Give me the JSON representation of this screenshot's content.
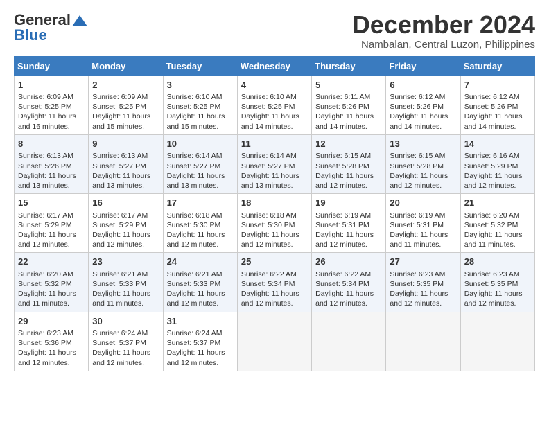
{
  "logo": {
    "line1": "General",
    "line2": "Blue"
  },
  "title": "December 2024",
  "location": "Nambalan, Central Luzon, Philippines",
  "days_of_week": [
    "Sunday",
    "Monday",
    "Tuesday",
    "Wednesday",
    "Thursday",
    "Friday",
    "Saturday"
  ],
  "weeks": [
    [
      {
        "day": 1,
        "sunrise": "6:09 AM",
        "sunset": "5:25 PM",
        "daylight": "11 hours and 16 minutes."
      },
      {
        "day": 2,
        "sunrise": "6:09 AM",
        "sunset": "5:25 PM",
        "daylight": "11 hours and 15 minutes."
      },
      {
        "day": 3,
        "sunrise": "6:10 AM",
        "sunset": "5:25 PM",
        "daylight": "11 hours and 15 minutes."
      },
      {
        "day": 4,
        "sunrise": "6:10 AM",
        "sunset": "5:25 PM",
        "daylight": "11 hours and 14 minutes."
      },
      {
        "day": 5,
        "sunrise": "6:11 AM",
        "sunset": "5:26 PM",
        "daylight": "11 hours and 14 minutes."
      },
      {
        "day": 6,
        "sunrise": "6:12 AM",
        "sunset": "5:26 PM",
        "daylight": "11 hours and 14 minutes."
      },
      {
        "day": 7,
        "sunrise": "6:12 AM",
        "sunset": "5:26 PM",
        "daylight": "11 hours and 14 minutes."
      }
    ],
    [
      {
        "day": 8,
        "sunrise": "6:13 AM",
        "sunset": "5:26 PM",
        "daylight": "11 hours and 13 minutes."
      },
      {
        "day": 9,
        "sunrise": "6:13 AM",
        "sunset": "5:27 PM",
        "daylight": "11 hours and 13 minutes."
      },
      {
        "day": 10,
        "sunrise": "6:14 AM",
        "sunset": "5:27 PM",
        "daylight": "11 hours and 13 minutes."
      },
      {
        "day": 11,
        "sunrise": "6:14 AM",
        "sunset": "5:27 PM",
        "daylight": "11 hours and 13 minutes."
      },
      {
        "day": 12,
        "sunrise": "6:15 AM",
        "sunset": "5:28 PM",
        "daylight": "11 hours and 12 minutes."
      },
      {
        "day": 13,
        "sunrise": "6:15 AM",
        "sunset": "5:28 PM",
        "daylight": "11 hours and 12 minutes."
      },
      {
        "day": 14,
        "sunrise": "6:16 AM",
        "sunset": "5:29 PM",
        "daylight": "11 hours and 12 minutes."
      }
    ],
    [
      {
        "day": 15,
        "sunrise": "6:17 AM",
        "sunset": "5:29 PM",
        "daylight": "11 hours and 12 minutes."
      },
      {
        "day": 16,
        "sunrise": "6:17 AM",
        "sunset": "5:29 PM",
        "daylight": "11 hours and 12 minutes."
      },
      {
        "day": 17,
        "sunrise": "6:18 AM",
        "sunset": "5:30 PM",
        "daylight": "11 hours and 12 minutes."
      },
      {
        "day": 18,
        "sunrise": "6:18 AM",
        "sunset": "5:30 PM",
        "daylight": "11 hours and 12 minutes."
      },
      {
        "day": 19,
        "sunrise": "6:19 AM",
        "sunset": "5:31 PM",
        "daylight": "11 hours and 12 minutes."
      },
      {
        "day": 20,
        "sunrise": "6:19 AM",
        "sunset": "5:31 PM",
        "daylight": "11 hours and 11 minutes."
      },
      {
        "day": 21,
        "sunrise": "6:20 AM",
        "sunset": "5:32 PM",
        "daylight": "11 hours and 11 minutes."
      }
    ],
    [
      {
        "day": 22,
        "sunrise": "6:20 AM",
        "sunset": "5:32 PM",
        "daylight": "11 hours and 11 minutes."
      },
      {
        "day": 23,
        "sunrise": "6:21 AM",
        "sunset": "5:33 PM",
        "daylight": "11 hours and 11 minutes."
      },
      {
        "day": 24,
        "sunrise": "6:21 AM",
        "sunset": "5:33 PM",
        "daylight": "11 hours and 12 minutes."
      },
      {
        "day": 25,
        "sunrise": "6:22 AM",
        "sunset": "5:34 PM",
        "daylight": "11 hours and 12 minutes."
      },
      {
        "day": 26,
        "sunrise": "6:22 AM",
        "sunset": "5:34 PM",
        "daylight": "11 hours and 12 minutes."
      },
      {
        "day": 27,
        "sunrise": "6:23 AM",
        "sunset": "5:35 PM",
        "daylight": "11 hours and 12 minutes."
      },
      {
        "day": 28,
        "sunrise": "6:23 AM",
        "sunset": "5:35 PM",
        "daylight": "11 hours and 12 minutes."
      }
    ],
    [
      {
        "day": 29,
        "sunrise": "6:23 AM",
        "sunset": "5:36 PM",
        "daylight": "11 hours and 12 minutes."
      },
      {
        "day": 30,
        "sunrise": "6:24 AM",
        "sunset": "5:37 PM",
        "daylight": "11 hours and 12 minutes."
      },
      {
        "day": 31,
        "sunrise": "6:24 AM",
        "sunset": "5:37 PM",
        "daylight": "11 hours and 12 minutes."
      },
      null,
      null,
      null,
      null
    ]
  ]
}
